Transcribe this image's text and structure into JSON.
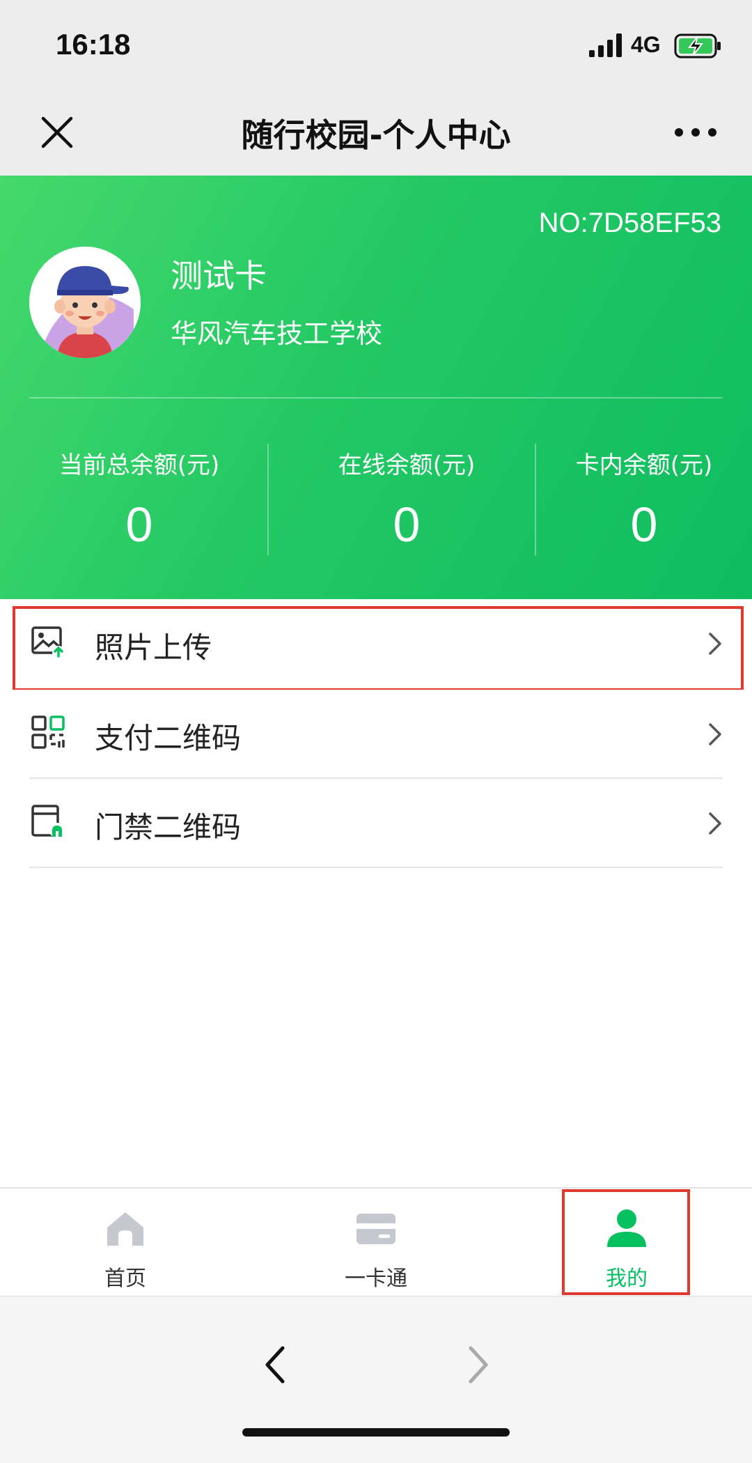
{
  "status_bar": {
    "time": "16:18",
    "network": "4G"
  },
  "title_bar": {
    "title": "随行校园-个人中心",
    "close_icon": "close-icon",
    "more_icon": "more-icon"
  },
  "profile": {
    "card_no": "NO:7D58EF53",
    "name": "测试卡",
    "school": "华风汽车技工学校",
    "balances": [
      {
        "label": "当前总余额(元)",
        "value": "0"
      },
      {
        "label": "在线余额(元)",
        "value": "0"
      },
      {
        "label": "卡内余额(元)",
        "value": "0"
      }
    ]
  },
  "menu": [
    {
      "label": "照片上传",
      "icon": "photo-upload-icon",
      "highlighted": true
    },
    {
      "label": "支付二维码",
      "icon": "qr-code-icon",
      "highlighted": false
    },
    {
      "label": "门禁二维码",
      "icon": "access-control-icon",
      "highlighted": false
    }
  ],
  "tabs": [
    {
      "label": "首页",
      "icon": "home-icon",
      "active": false
    },
    {
      "label": "一卡通",
      "icon": "card-icon",
      "active": false
    },
    {
      "label": "我的",
      "icon": "user-icon",
      "active": true
    }
  ],
  "colors": {
    "accent": "#07c160",
    "highlight_border": "#e03a2f",
    "inactive_icon": "#c5c8ce"
  }
}
